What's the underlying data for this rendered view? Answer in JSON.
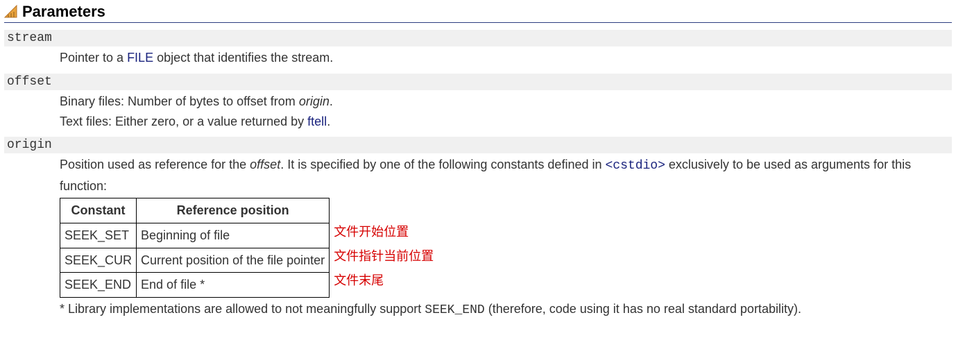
{
  "heading": "Parameters",
  "params": {
    "stream": {
      "term": "stream",
      "desc_prefix": "Pointer to a ",
      "file_link": "FILE",
      "desc_suffix": " object that identifies the stream."
    },
    "offset": {
      "term": "offset",
      "line1_prefix": "Binary files: Number of bytes to offset from ",
      "origin_word": "origin",
      "line1_suffix": ".",
      "line2_prefix": "Text files: Either zero, or a value returned by ",
      "ftell_link": "ftell",
      "line2_suffix": "."
    },
    "origin": {
      "term": "origin",
      "desc_prefix": "Position used as reference for the ",
      "offset_word": "offset",
      "desc_mid": ". It is specified by one of the following constants defined in ",
      "cstdio_link": "<cstdio>",
      "desc_suffix": " exclusively to be used as arguments for this function:",
      "table": {
        "head_constant": "Constant",
        "head_refpos": "Reference position",
        "rows": [
          {
            "constant": "SEEK_SET",
            "refpos": "Beginning of file"
          },
          {
            "constant": "SEEK_CUR",
            "refpos": "Current position of the file pointer"
          },
          {
            "constant": "SEEK_END",
            "refpos": "End of file *"
          }
        ]
      },
      "annotations": [
        "文件开始位置",
        "文件指针当前位置",
        "文件末尾"
      ],
      "footnote_prefix": "* Library implementations are allowed to not meaningfully support ",
      "seek_end_code": "SEEK_END",
      "footnote_suffix": " (therefore, code using it has no real standard portability)."
    }
  }
}
